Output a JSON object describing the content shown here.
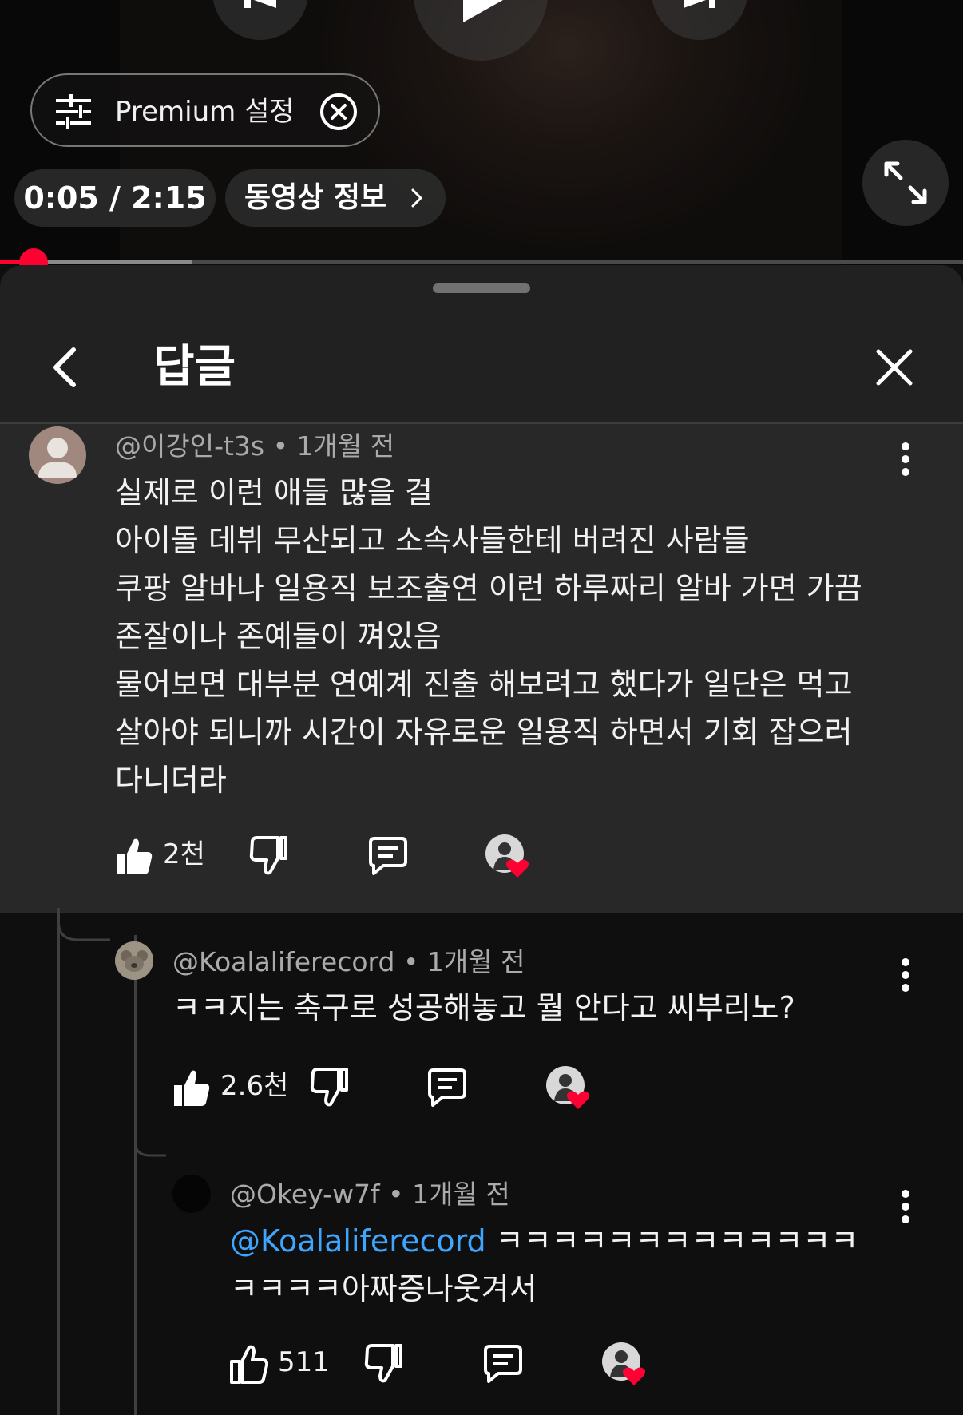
{
  "player": {
    "premium_label": "Premium 설정",
    "time": "0:05 / 2:15",
    "video_info_label": "동영상 정보",
    "progress_played_fraction": 0.035,
    "progress_buffered_fraction": 0.2,
    "accent_color": "#ff0033"
  },
  "panel": {
    "title": "답글"
  },
  "comments": [
    {
      "meta": "@이강인-t3s • 1개월 전",
      "text": "실제로 이런 애들 많을 걸\n아이돌 데뷔 무산되고 소속사들한테 버려진 사람들\n쿠팡 알바나 일용직 보조출연 이런 하루짜리 알바 가면 가끔\n존잘이나 존예들이 껴있음\n물어보면 대부분 연예계 진출 해보려고 했다가 일단은 먹고\n살아야 되니까 시간이 자유로운 일용직 하면서 기회 잡으러\n다니더라",
      "likes": "2천"
    },
    {
      "meta": "@Koalaliferecord • 1개월 전",
      "text": "ㅋㅋ지는 축구로 성공해놓고 뭘 안다고 씨부리노?",
      "likes": "2.6천"
    },
    {
      "meta": "@Okey-w7f • 1개월 전",
      "mention": "@Koalaliferecord",
      "text_rest": " ㅋㅋㅋㅋㅋㅋㅋㅋㅋㅋㅋㅋㅋ",
      "text_line2": "ㅋㅋㅋㅋ아짜증나웃겨서",
      "likes": "511"
    }
  ],
  "icons": [
    "tune-icon",
    "close-circle-icon",
    "chevron-right-icon",
    "fullscreen-icon",
    "back-arrow-icon",
    "close-icon",
    "more-vert-icon",
    "thumb-up-icon",
    "thumb-down-icon",
    "reply-icon",
    "creator-heart-icon"
  ]
}
